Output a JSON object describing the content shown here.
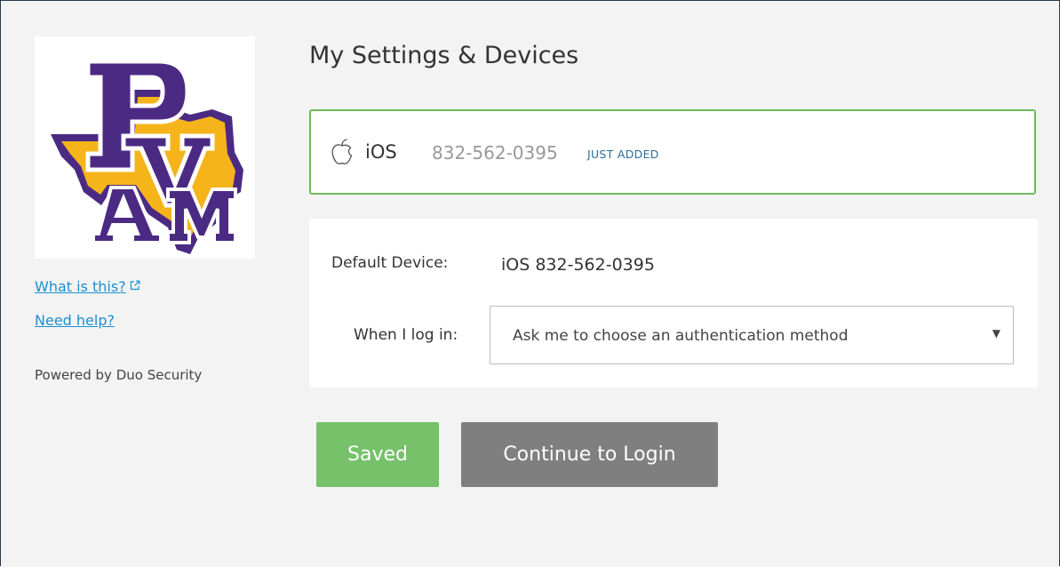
{
  "sidebar": {
    "logo_alt": "PVAMU",
    "what_is_this": "What is this?",
    "need_help": "Need help?",
    "powered_by": "Powered by Duo Security"
  },
  "main": {
    "title": "My Settings & Devices",
    "device": {
      "icon": "apple-icon",
      "os": "iOS",
      "phone": "832-562-0395",
      "badge": "JUST ADDED"
    },
    "settings": {
      "default_device_label": "Default Device:",
      "default_device_value": "iOS 832-562-0395",
      "when_login_label": "When I log in:",
      "when_login_value": "Ask me to choose an authentication method"
    },
    "buttons": {
      "saved": "Saved",
      "continue": "Continue to Login"
    }
  },
  "colors": {
    "accent_green": "#76c16a",
    "card_border": "#6cbd59",
    "link": "#1b8fd0",
    "button_gray": "#7f7f7f",
    "logo_purple": "#4b2a84",
    "logo_gold": "#f6b41b"
  }
}
